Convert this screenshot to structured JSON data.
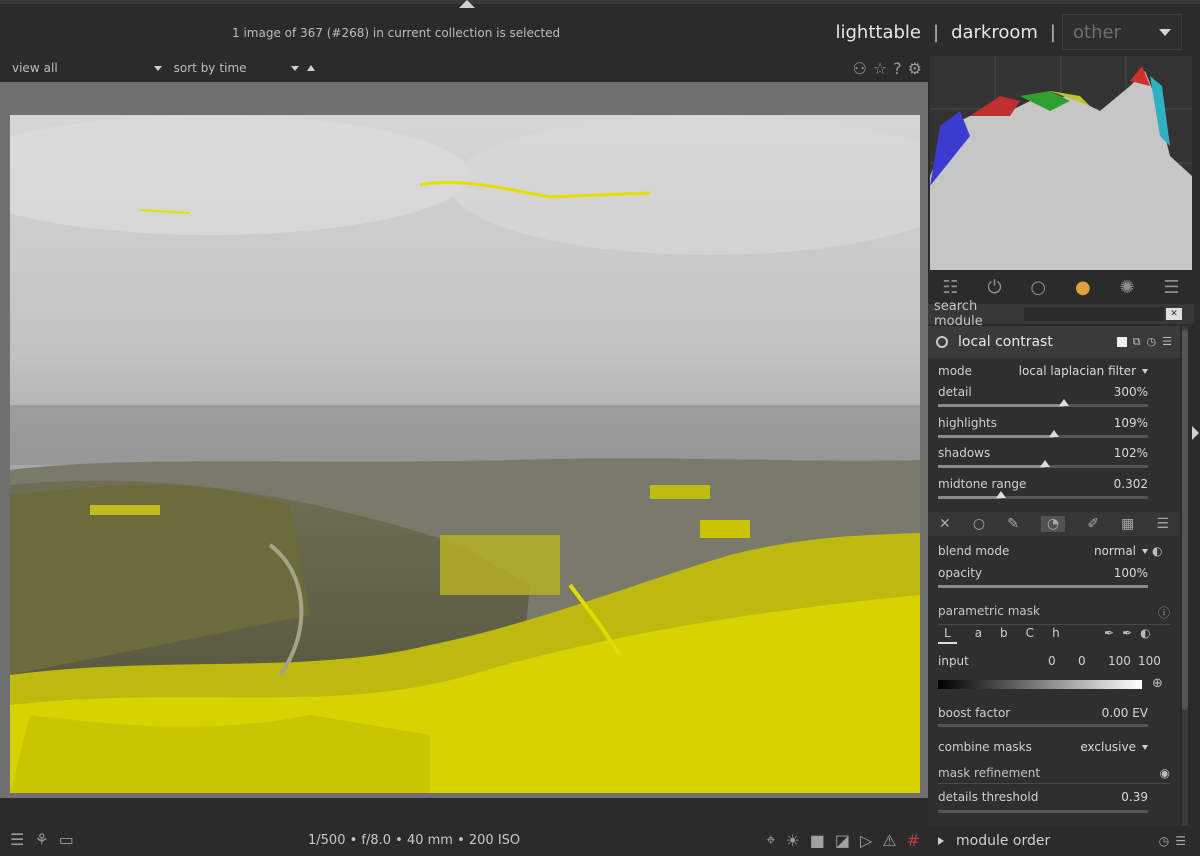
{
  "status": {
    "text": "1 image of 367 (#268) in current collection is selected"
  },
  "views": {
    "lighttable": "lighttable",
    "sep": "|",
    "darkroom": "darkroom",
    "other": "other"
  },
  "filter": {
    "view_label": "view",
    "view_value": "all",
    "sort_label": "sort by",
    "sort_value": "time"
  },
  "bottom": {
    "exif": "1/500 • f/8.0 • 40 mm • 200 ISO"
  },
  "search": {
    "label": "search module",
    "value": ""
  },
  "module": {
    "title": "local contrast",
    "mode": {
      "label": "mode",
      "value": "local laplacian filter"
    },
    "sliders": [
      {
        "label": "detail",
        "value": "300%",
        "fraction": 0.6
      },
      {
        "label": "highlights",
        "value": "109%",
        "fraction": 0.55
      },
      {
        "label": "shadows",
        "value": "102%",
        "fraction": 0.51
      },
      {
        "label": "midtone range",
        "value": "0.302",
        "fraction": 0.3
      }
    ],
    "blend": {
      "blend_mode_label": "blend mode",
      "blend_mode_value": "normal",
      "opacity_label": "opacity",
      "opacity_value": "100%",
      "opacity_fraction": 1.0,
      "parametric_mask": "parametric mask",
      "channels": [
        "L",
        "a",
        "b",
        "C",
        "h"
      ],
      "input_label": "input",
      "input_values": [
        "0",
        "0",
        "100",
        "100"
      ],
      "boost_label": "boost factor",
      "boost_value": "0.00 EV",
      "combine_label": "combine masks",
      "combine_value": "exclusive",
      "refine_label": "mask refinement",
      "details_label": "details threshold",
      "details_value": "0.39"
    }
  },
  "module_order": {
    "label": "module order"
  },
  "colors": {
    "bg": "#2b2b2b",
    "mask_yellow": "#d7d300",
    "canvas_gray": "#707070"
  }
}
